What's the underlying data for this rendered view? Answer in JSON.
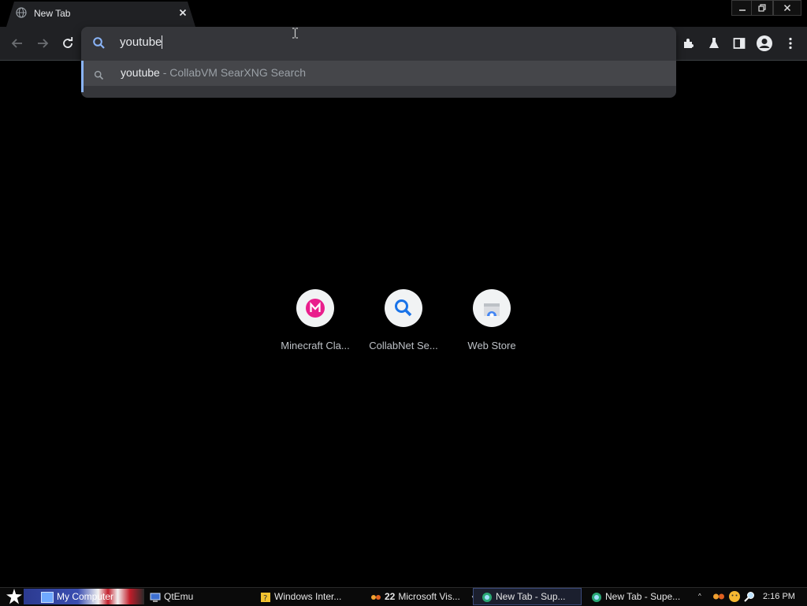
{
  "browser": {
    "tab_title": "New Tab",
    "omnibox_text": "youtube",
    "suggestion": {
      "query": "youtube",
      "separator": "-",
      "engine": "CollabVM SearXNG Search"
    }
  },
  "shortcuts": [
    {
      "label": "Minecraft Cla...",
      "icon": "minecraft-classic-icon",
      "color": "#e91e8c"
    },
    {
      "label": "CollabNet Se...",
      "icon": "search-icon",
      "color": "#1a73e8"
    },
    {
      "label": "Web Store",
      "icon": "web-store-icon",
      "color": "#4285f4"
    }
  ],
  "taskbar": {
    "items": [
      {
        "label": "My Computer",
        "icon": "computer-icon"
      },
      {
        "label": "QtEmu",
        "icon": "qtemu-icon"
      },
      {
        "label": "Windows Inter...",
        "icon": "help-icon"
      },
      {
        "count": "22",
        "label": "Microsoft Vis...",
        "icon": "visual-studio-icon"
      },
      {
        "label": "New Tab - Sup...",
        "icon": "browser-icon"
      },
      {
        "label": "New Tab - Supe...",
        "icon": "browser-icon"
      }
    ],
    "clock": "2:16 PM"
  }
}
